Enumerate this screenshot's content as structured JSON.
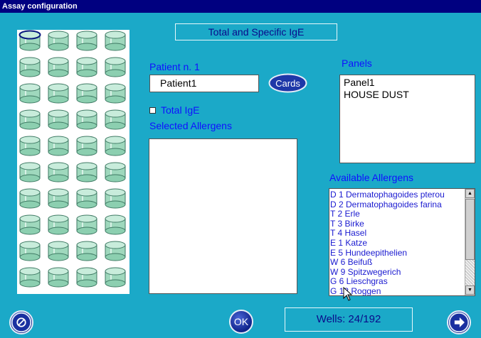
{
  "window": {
    "title": "Assay configuration"
  },
  "assay": {
    "title": "Total and Specific IgE"
  },
  "patient": {
    "label": "Patient n. 1",
    "value": "Patient1"
  },
  "cards_button": "Cards",
  "total_ige": {
    "label": "Total IgE",
    "checked": false
  },
  "selected_allergens": {
    "label": "Selected Allergens",
    "items": []
  },
  "panels": {
    "label": "Panels",
    "items": [
      "Panel1",
      "HOUSE DUST"
    ]
  },
  "available_allergens": {
    "label": "Available Allergens",
    "items": [
      "D 1 Dermatophagoides pterou",
      "D 2 Dermatophagoides farina",
      "T 2 Erle",
      "T 3 Birke",
      "T 4 Hasel",
      "E 1 Katze",
      "E 5 Hundeepithelien",
      "W 6 Beifuß",
      "W 9 Spitzwegerich",
      "G 6 Lieschgras",
      "G 12 Roggen"
    ]
  },
  "ok_button": "OK",
  "wells": {
    "text": "Wells: 24/192",
    "grid_rows": 10,
    "grid_cols": 4,
    "selected_well": 0
  },
  "colors": {
    "background": "#1ba9c8",
    "titlebar": "#000080",
    "label": "#1010ff",
    "button": "#10238a"
  }
}
